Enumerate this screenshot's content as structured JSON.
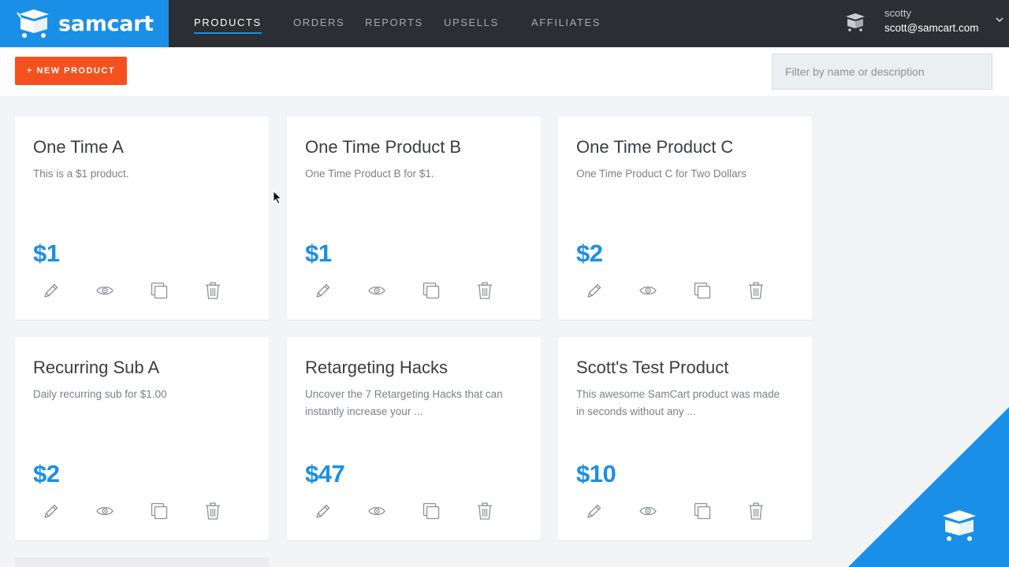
{
  "brand": {
    "name": "samcart",
    "color": "#1a8fe8"
  },
  "nav": {
    "items": [
      {
        "label": "PRODUCTS",
        "active": true
      },
      {
        "label": "ORDERS",
        "active": false
      },
      {
        "label": "REPORTS",
        "active": false
      },
      {
        "label": "UPSELLS",
        "active": false
      },
      {
        "label": "AFFILIATES",
        "active": false
      }
    ]
  },
  "user": {
    "name": "scotty",
    "email": "scott@samcart.com"
  },
  "toolbar": {
    "new_product_label": "+ NEW PRODUCT",
    "filter_placeholder": "Filter by name or description"
  },
  "products": [
    {
      "title": "One Time A",
      "description": "This is a $1 product.",
      "price": "$1"
    },
    {
      "title": "One Time Product B",
      "description": "One Time Product B for $1.",
      "price": "$1"
    },
    {
      "title": "One Time Product C",
      "description": "One Time Product C for Two Dollars",
      "price": "$2"
    },
    {
      "title": "Recurring Sub A",
      "description": "Daily recurring sub for $1.00",
      "price": "$2"
    },
    {
      "title": "Retargeting Hacks",
      "description": "Uncover the 7 Retargeting Hacks that can instantly increase your ...",
      "price": "$47"
    },
    {
      "title": "Scott's Test Product",
      "description": "This awesome SamCart product was made in seconds without any ...",
      "price": "$10"
    }
  ],
  "card_actions": [
    "pencil-icon",
    "eye-icon",
    "copy-icon",
    "trash-icon"
  ],
  "colors": {
    "accent": "#1a8fe8",
    "button": "#f5511e",
    "topbar": "#2b2e33"
  }
}
